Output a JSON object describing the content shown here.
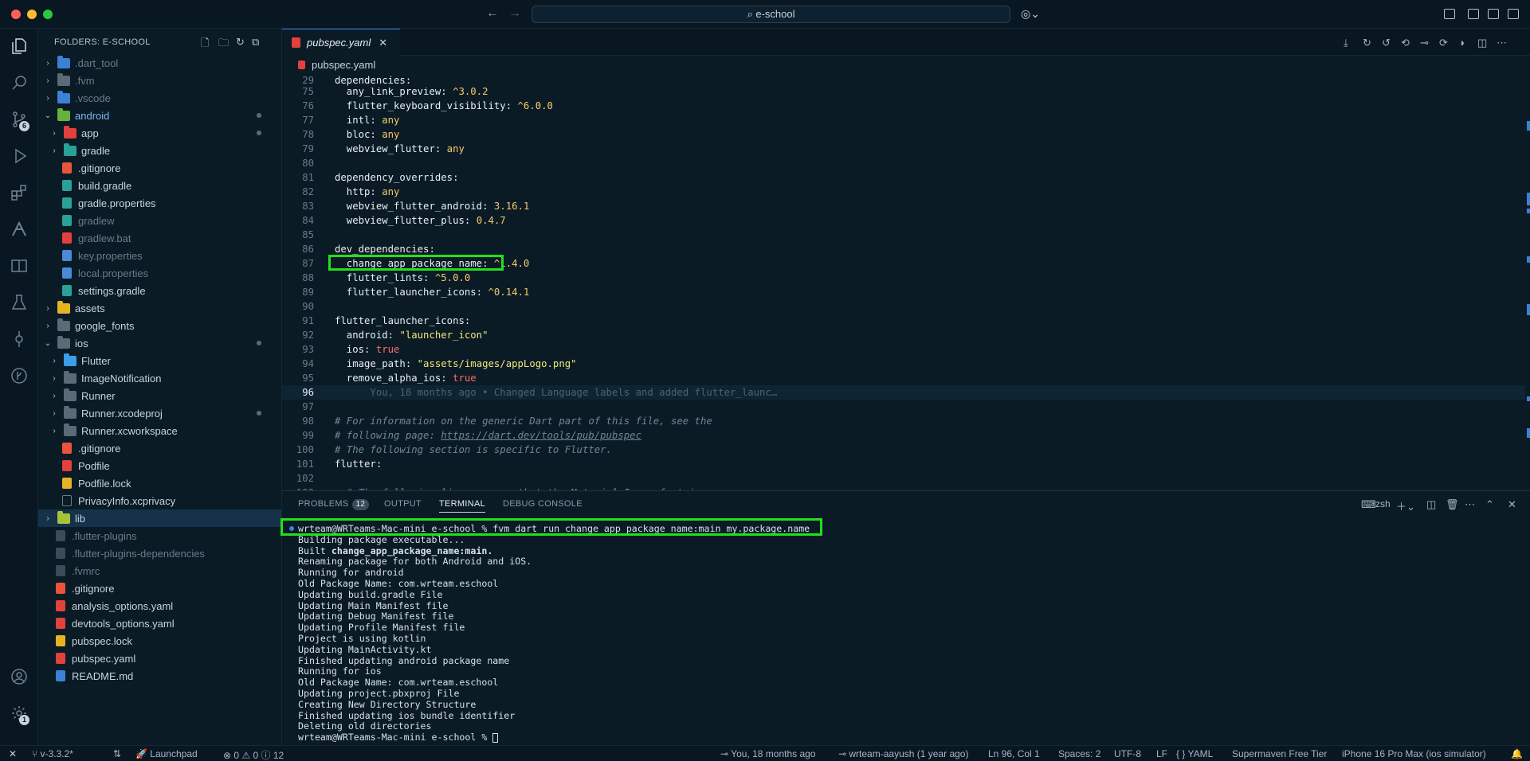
{
  "window": {
    "search_text": "e-school"
  },
  "activity": {
    "scm_badge": "6",
    "settings_badge": "1"
  },
  "sidebar": {
    "title": "FOLDERS: E-SCHOOL",
    "items": [
      {
        "label": ".dart_tool",
        "depth": 0,
        "type": "folder",
        "chev": "›",
        "dim": true,
        "color": "#3b82d6"
      },
      {
        "label": ".fvm",
        "depth": 0,
        "type": "folder",
        "chev": "›",
        "dim": true,
        "color": "#5a6b78"
      },
      {
        "label": ".vscode",
        "depth": 0,
        "type": "folder",
        "chev": "›",
        "dim": true,
        "color": "#3b82d6"
      },
      {
        "label": "android",
        "depth": 0,
        "type": "folder",
        "chev": "⌄",
        "dim": false,
        "color": "#63b33d",
        "mod": true
      },
      {
        "label": "app",
        "depth": 1,
        "type": "folder",
        "chev": "›",
        "dim": false,
        "color": "#e3413c",
        "mod": true
      },
      {
        "label": "gradle",
        "depth": 1,
        "type": "folder",
        "chev": "›",
        "dim": false,
        "color": "#2aa198"
      },
      {
        "label": ".gitignore",
        "depth": 1,
        "type": "file",
        "dim": false,
        "color": "#e8553a"
      },
      {
        "label": "build.gradle",
        "depth": 1,
        "type": "file",
        "dim": false,
        "color": "#2aa198"
      },
      {
        "label": "gradle.properties",
        "depth": 1,
        "type": "file",
        "dim": false,
        "color": "#2aa198"
      },
      {
        "label": "gradlew",
        "depth": 1,
        "type": "file",
        "dim": true,
        "color": "#2aa198"
      },
      {
        "label": "gradlew.bat",
        "depth": 1,
        "type": "file",
        "dim": true,
        "color": "#e3413c"
      },
      {
        "label": "key.properties",
        "depth": 1,
        "type": "file",
        "dim": true,
        "color": "#4a8ad8"
      },
      {
        "label": "local.properties",
        "depth": 1,
        "type": "file",
        "dim": true,
        "color": "#4a8ad8"
      },
      {
        "label": "settings.gradle",
        "depth": 1,
        "type": "file",
        "dim": false,
        "color": "#2aa198"
      },
      {
        "label": "assets",
        "depth": 0,
        "type": "folder",
        "chev": "›",
        "dim": false,
        "color": "#e6b422"
      },
      {
        "label": "google_fonts",
        "depth": 0,
        "type": "folder",
        "chev": "›",
        "dim": false,
        "color": "#5a6b78"
      },
      {
        "label": "ios",
        "depth": 0,
        "type": "folder",
        "chev": "⌄",
        "dim": false,
        "color": "#5a6b78",
        "mod": true
      },
      {
        "label": "Flutter",
        "depth": 1,
        "type": "folder",
        "chev": "›",
        "dim": false,
        "color": "#3b9ee8"
      },
      {
        "label": "ImageNotification",
        "depth": 1,
        "type": "folder",
        "chev": "›",
        "dim": false,
        "color": "#5a6b78"
      },
      {
        "label": "Runner",
        "depth": 1,
        "type": "folder",
        "chev": "›",
        "dim": false,
        "color": "#5a6b78"
      },
      {
        "label": "Runner.xcodeproj",
        "depth": 1,
        "type": "folder",
        "chev": "›",
        "dim": false,
        "color": "#5a6b78",
        "mod": true
      },
      {
        "label": "Runner.xcworkspace",
        "depth": 1,
        "type": "folder",
        "chev": "›",
        "dim": false,
        "color": "#5a6b78"
      },
      {
        "label": ".gitignore",
        "depth": 1,
        "type": "file",
        "dim": false,
        "color": "#e8553a"
      },
      {
        "label": "Podfile",
        "depth": 1,
        "type": "file",
        "dim": false,
        "color": "#e3413c"
      },
      {
        "label": "Podfile.lock",
        "depth": 1,
        "type": "file",
        "dim": false,
        "color": "#e6b422"
      },
      {
        "label": "PrivacyInfo.xcprivacy",
        "depth": 1,
        "type": "file",
        "dim": false,
        "color": "#0a1b26"
      },
      {
        "label": "lib",
        "depth": 0,
        "type": "folder",
        "chev": "›",
        "dim": false,
        "color": "#a6c43a",
        "selected": true
      },
      {
        "label": ".flutter-plugins",
        "depth": 0,
        "type": "file",
        "dim": true,
        "color": "#3a4c5a"
      },
      {
        "label": ".flutter-plugins-dependencies",
        "depth": 0,
        "type": "file",
        "dim": true,
        "color": "#3a4c5a"
      },
      {
        "label": ".fvmrc",
        "depth": 0,
        "type": "file",
        "dim": true,
        "color": "#3a4c5a"
      },
      {
        "label": ".gitignore",
        "depth": 0,
        "type": "file",
        "dim": false,
        "color": "#e8553a"
      },
      {
        "label": "analysis_options.yaml",
        "depth": 0,
        "type": "file",
        "dim": false,
        "color": "#e3413c"
      },
      {
        "label": "devtools_options.yaml",
        "depth": 0,
        "type": "file",
        "dim": false,
        "color": "#e3413c"
      },
      {
        "label": "pubspec.lock",
        "depth": 0,
        "type": "file",
        "dim": false,
        "color": "#e6b422"
      },
      {
        "label": "pubspec.yaml",
        "depth": 0,
        "type": "file",
        "dim": false,
        "color": "#e3413c"
      },
      {
        "label": "README.md",
        "depth": 0,
        "type": "file",
        "dim": false,
        "color": "#3b82d6"
      }
    ]
  },
  "editor": {
    "tab_label": "pubspec.yaml",
    "breadcrumb": "pubspec.yaml",
    "sticky_line": {
      "n": "29",
      "segs": [
        [
          "k",
          "dependencies:"
        ]
      ]
    },
    "lines": [
      {
        "n": "75",
        "segs": [
          [
            "k",
            "  any_link_preview: "
          ],
          [
            "v-num",
            "^3.0.2"
          ]
        ]
      },
      {
        "n": "76",
        "segs": [
          [
            "k",
            "  flutter_keyboard_visibility: "
          ],
          [
            "v-num",
            "^6.0.0"
          ]
        ]
      },
      {
        "n": "77",
        "segs": [
          [
            "k",
            "  intl: "
          ],
          [
            "v-num",
            "any"
          ]
        ]
      },
      {
        "n": "78",
        "segs": [
          [
            "k",
            "  bloc: "
          ],
          [
            "v-num",
            "any"
          ]
        ]
      },
      {
        "n": "79",
        "segs": [
          [
            "k",
            "  webview_flutter: "
          ],
          [
            "v-num",
            "any"
          ]
        ]
      },
      {
        "n": "80",
        "segs": []
      },
      {
        "n": "81",
        "segs": [
          [
            "k",
            "dependency_overrides:"
          ]
        ]
      },
      {
        "n": "82",
        "segs": [
          [
            "k",
            "  http: "
          ],
          [
            "v-num",
            "any"
          ]
        ]
      },
      {
        "n": "83",
        "segs": [
          [
            "k",
            "  webview_flutter_android: "
          ],
          [
            "v-num",
            "3.16.1"
          ]
        ]
      },
      {
        "n": "84",
        "segs": [
          [
            "k",
            "  webview_flutter_plus: "
          ],
          [
            "v-num",
            "0.4.7"
          ]
        ]
      },
      {
        "n": "85",
        "segs": []
      },
      {
        "n": "86",
        "segs": [
          [
            "k",
            "dev_dependencies:"
          ]
        ]
      },
      {
        "n": "87",
        "segs": [
          [
            "k",
            "  change_app_package_name: "
          ],
          [
            "v-num",
            "^1.4.0"
          ]
        ],
        "highlight": true
      },
      {
        "n": "88",
        "segs": [
          [
            "k",
            "  flutter_lints: "
          ],
          [
            "v-num",
            "^5.0.0"
          ]
        ]
      },
      {
        "n": "89",
        "segs": [
          [
            "k",
            "  flutter_launcher_icons: "
          ],
          [
            "v-num",
            "^0.14.1"
          ]
        ]
      },
      {
        "n": "90",
        "segs": []
      },
      {
        "n": "91",
        "segs": [
          [
            "k",
            "flutter_launcher_icons:"
          ]
        ]
      },
      {
        "n": "92",
        "segs": [
          [
            "k",
            "  android: "
          ],
          [
            "v-str",
            "\"launcher_icon\""
          ]
        ]
      },
      {
        "n": "93",
        "segs": [
          [
            "k",
            "  ios: "
          ],
          [
            "v-bool",
            "true"
          ]
        ]
      },
      {
        "n": "94",
        "segs": [
          [
            "k",
            "  image_path: "
          ],
          [
            "v-str",
            "\"assets/images/appLogo.png\""
          ]
        ]
      },
      {
        "n": "95",
        "segs": [
          [
            "k",
            "  remove_alpha_ios: "
          ],
          [
            "v-bool",
            "true"
          ]
        ]
      },
      {
        "n": "96",
        "segs": [
          [
            "blame",
            "      You, 18 months ago • Changed Language labels and added flutter_launc…"
          ]
        ],
        "current": true
      },
      {
        "n": "97",
        "segs": []
      },
      {
        "n": "98",
        "segs": [
          [
            "cmt",
            "# For information on the generic Dart part of this file, see the"
          ]
        ]
      },
      {
        "n": "99",
        "segs": [
          [
            "cmt",
            "# following page: "
          ],
          [
            "url",
            "https://dart.dev/tools/pub/pubspec"
          ]
        ]
      },
      {
        "n": "100",
        "segs": [
          [
            "cmt",
            "# The following section is specific to Flutter."
          ]
        ]
      },
      {
        "n": "101",
        "segs": [
          [
            "k",
            "flutter:"
          ]
        ]
      },
      {
        "n": "102",
        "segs": []
      },
      {
        "n": "103",
        "segs": [
          [
            "cmt",
            "  # The following line ensures that the Material Icons font is"
          ]
        ]
      }
    ]
  },
  "panel": {
    "tabs": [
      {
        "label": "PROBLEMS",
        "badge": "12"
      },
      {
        "label": "OUTPUT"
      },
      {
        "label": "TERMINAL",
        "active": true
      },
      {
        "label": "DEBUG CONSOLE"
      }
    ],
    "shell_name": "zsh",
    "terminal_lines": [
      {
        "text": "wrteam@WRTeams-Mac-mini e-school % fvm dart run change_app_package_name:main my.package.name"
      },
      {
        "text": "Building package executable..."
      },
      {
        "text": "Built ",
        "bold": "change_app_package_name:main."
      },
      {
        "text": "Renaming package for both Android and iOS."
      },
      {
        "text": "Running for android"
      },
      {
        "text": "Old Package Name: com.wrteam.eschool"
      },
      {
        "text": "Updating build.gradle File"
      },
      {
        "text": "Updating Main Manifest file"
      },
      {
        "text": "Updating Debug Manifest file"
      },
      {
        "text": "Updating Profile Manifest file"
      },
      {
        "text": "Project is using kotlin"
      },
      {
        "text": "Updating MainActivity.kt"
      },
      {
        "text": "Finished updating android package name"
      },
      {
        "text": "Running for ios"
      },
      {
        "text": "Old Package Name: com.wrteam.eschool"
      },
      {
        "text": "Updating project.pbxproj File"
      },
      {
        "text": "Creating New Directory Structure"
      },
      {
        "text": "Finished updating ios bundle identifier"
      },
      {
        "text": "Deleting old directories"
      },
      {
        "text": "wrteam@WRTeams-Mac-mini e-school % ",
        "cursor": true
      }
    ]
  },
  "statusbar": {
    "branch": "v-3.3.2*",
    "launchpad": "Launchpad",
    "problems": "⊗ 0 ⚠ 0 ⓘ 12",
    "blame": "You, 18 months ago",
    "author": "wrteam-aayush (1 year ago)",
    "position": "Ln 96, Col 1",
    "spaces": "Spaces: 2",
    "encoding": "UTF-8",
    "eol": "LF",
    "language": "{ } YAML",
    "supermaven": "Supermaven Free Tier",
    "device": "iPhone 16 Pro Max (ios simulator)"
  },
  "colors": {
    "highlight": "#22e01c",
    "accent": "#3b82d6"
  }
}
